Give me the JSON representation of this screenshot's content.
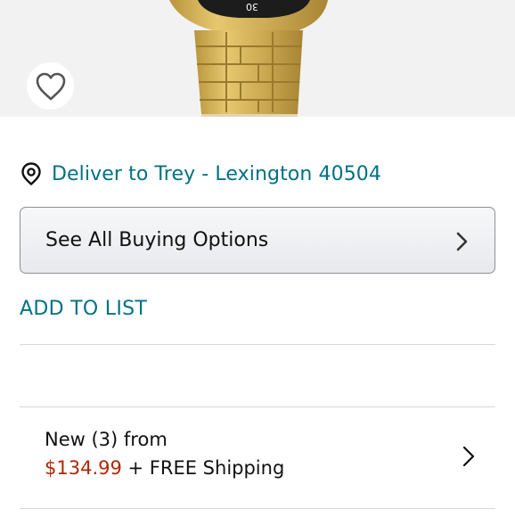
{
  "product": {
    "watch_dial_number": "30"
  },
  "delivery": {
    "text": "Deliver to Trey - Lexington 40504"
  },
  "buying_options": {
    "label": "See All Buying Options"
  },
  "add_to_list": {
    "label": "ADD TO LIST"
  },
  "offer": {
    "condition_label": "New (3) from",
    "price": "$134.99",
    "shipping": " + FREE Shipping"
  },
  "colors": {
    "link": "#007185",
    "price": "#b12704",
    "text": "#0f1111",
    "image_bg": "#f2f2f2",
    "watch_gold": "#d4b253"
  },
  "icons": {
    "wishlist": "heart-outline-icon",
    "location": "location-pin-icon",
    "buying_chevron": "chevron-right-icon",
    "offer_chevron": "chevron-right-icon"
  }
}
